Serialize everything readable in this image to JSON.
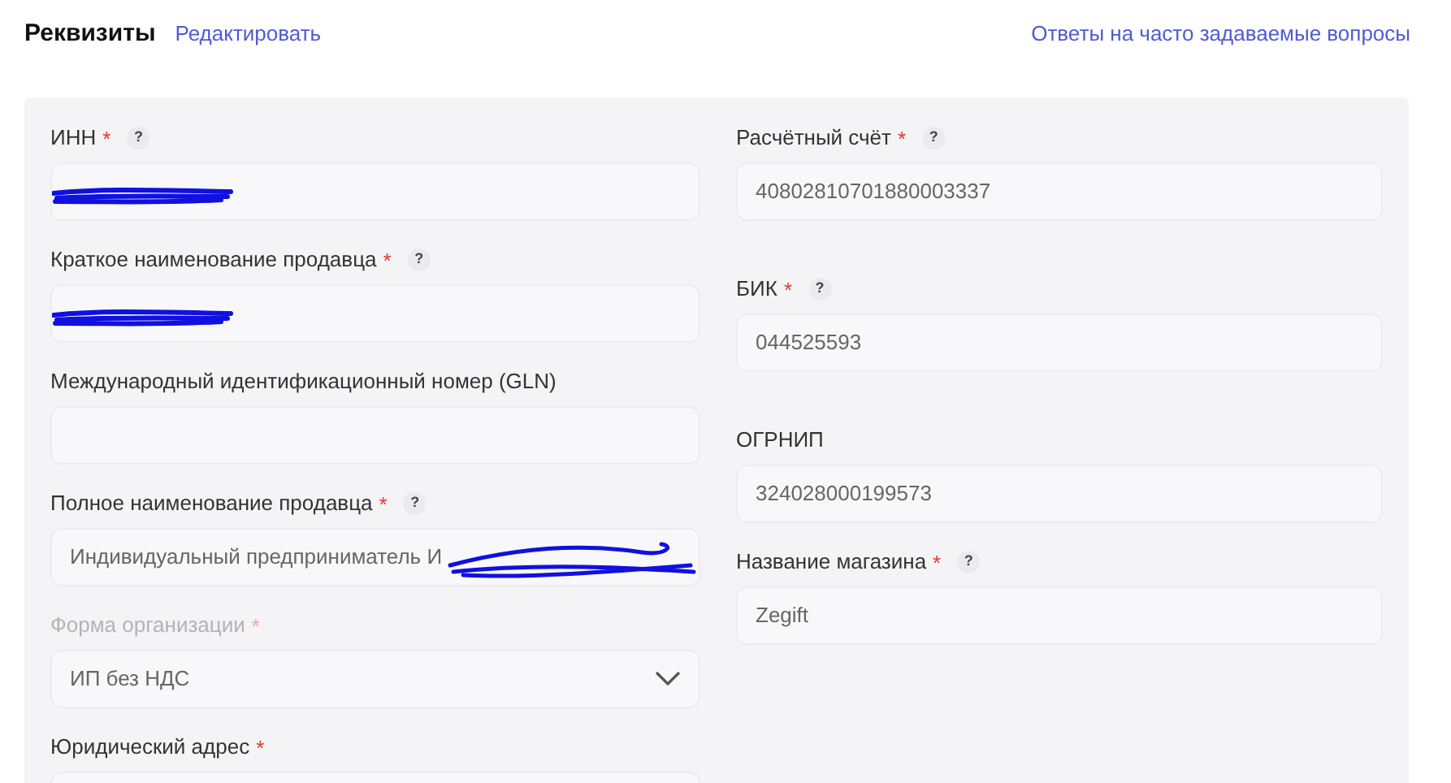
{
  "header": {
    "title": "Реквизиты",
    "edit_link": "Редактировать",
    "faq_link": "Ответы на часто задаваемые вопросы"
  },
  "left_fields": [
    {
      "kind": "text",
      "label": "ИНН",
      "required_mark": "*",
      "help": "?",
      "disabled": false,
      "redacted": true
    },
    {
      "kind": "text",
      "label": "Краткое наименование продавца",
      "required_mark": "*",
      "help": "?",
      "disabled": false,
      "redacted": true
    },
    {
      "kind": "text",
      "label": "Международный идентификационный номер (GLN)",
      "disabled": false,
      "redacted": false
    },
    {
      "kind": "text",
      "label": "Полное наименование продавца",
      "required_mark": "*",
      "help": "?",
      "disabled": false,
      "value": "Индивидуальный предприниматель И",
      "redacted": true
    },
    {
      "kind": "select",
      "label": "Форма организации",
      "required_mark": "*",
      "disabled": true,
      "value": "ИП без НДС",
      "redacted": false
    },
    {
      "kind": "text",
      "label": "Юридический адрес",
      "required_mark": "*",
      "disabled": false
    }
  ],
  "right_fields": [
    {
      "kind": "text",
      "label": "Расчётный счёт",
      "required_mark": "*",
      "help": "?",
      "disabled": false,
      "value": "40802810701880003337",
      "redacted": false
    },
    {
      "kind": "text",
      "label": "БИК",
      "required_mark": "*",
      "help": "?",
      "disabled": false,
      "value": "044525593",
      "redacted": false
    },
    {
      "kind": "text",
      "label": "ОГРНИП",
      "disabled": false,
      "value": "324028000199573",
      "redacted": false
    },
    {
      "kind": "text",
      "label": "Название магазина",
      "required_mark": "*",
      "help": "?",
      "disabled": false,
      "value": "Zegift",
      "redacted": false
    }
  ]
}
